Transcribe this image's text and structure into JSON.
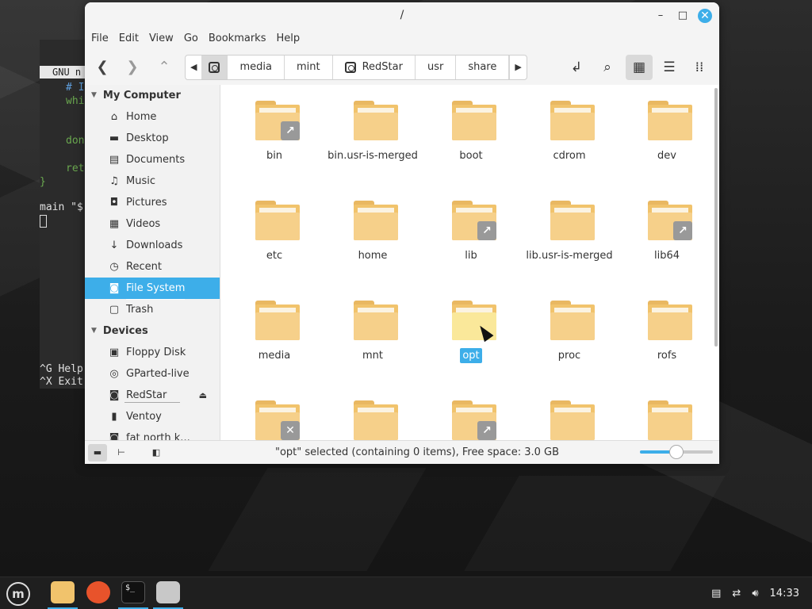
{
  "window": {
    "title": "/"
  },
  "menubar": [
    "File",
    "Edit",
    "View",
    "Go",
    "Bookmarks",
    "Help"
  ],
  "breadcrumbs": [
    "media",
    "mint",
    "RedStar",
    "usr",
    "share"
  ],
  "sidebar": {
    "sections": [
      {
        "title": "My Computer",
        "items": [
          {
            "label": "Home",
            "icon": "home-icon",
            "glyph": "⌂"
          },
          {
            "label": "Desktop",
            "icon": "desktop-icon",
            "glyph": "▬"
          },
          {
            "label": "Documents",
            "icon": "documents-icon",
            "glyph": "▤"
          },
          {
            "label": "Music",
            "icon": "music-icon",
            "glyph": "♫"
          },
          {
            "label": "Pictures",
            "icon": "camera-icon",
            "glyph": "◘"
          },
          {
            "label": "Videos",
            "icon": "film-icon",
            "glyph": "▦"
          },
          {
            "label": "Downloads",
            "icon": "download-icon",
            "glyph": "↓"
          },
          {
            "label": "Recent",
            "icon": "clock-icon",
            "glyph": "◷"
          },
          {
            "label": "File System",
            "icon": "drive-icon",
            "glyph": "◙",
            "selected": true
          },
          {
            "label": "Trash",
            "icon": "trash-icon",
            "glyph": "▢"
          }
        ]
      },
      {
        "title": "Devices",
        "items": [
          {
            "label": "Floppy Disk",
            "icon": "floppy-icon",
            "glyph": "▣"
          },
          {
            "label": "GParted-live",
            "icon": "disc-icon",
            "glyph": "◎"
          },
          {
            "label": "RedStar",
            "icon": "drive-icon",
            "glyph": "◙",
            "eject": true
          },
          {
            "label": "Ventoy",
            "icon": "usb-icon",
            "glyph": "▮"
          },
          {
            "label": "fat north k...",
            "icon": "drive-icon",
            "glyph": "◙"
          }
        ]
      }
    ]
  },
  "files": [
    {
      "name": "bin",
      "emblem": "link"
    },
    {
      "name": "bin.usr-is-merged"
    },
    {
      "name": "boot"
    },
    {
      "name": "cdrom"
    },
    {
      "name": "dev"
    },
    {
      "name": "etc"
    },
    {
      "name": "home"
    },
    {
      "name": "lib",
      "emblem": "link"
    },
    {
      "name": "lib.usr-is-merged"
    },
    {
      "name": "lib64",
      "emblem": "link"
    },
    {
      "name": "media"
    },
    {
      "name": "mnt"
    },
    {
      "name": "opt",
      "selected": true
    },
    {
      "name": "proc"
    },
    {
      "name": "rofs"
    },
    {
      "name": "",
      "emblem": "unreadable"
    },
    {
      "name": ""
    },
    {
      "name": "",
      "emblem": "link"
    },
    {
      "name": ""
    },
    {
      "name": ""
    }
  ],
  "status": {
    "text": "\"opt\" selected (containing 0 items), Free space: 3.0 GB",
    "zoom_level": 0.5
  },
  "terminal": {
    "header": "GNU n",
    "lines": [
      {
        "text": "# I",
        "cls": "cmt"
      },
      {
        "text": "whi",
        "cls": "grn"
      },
      {
        "text": "don",
        "cls": "grn"
      },
      {
        "text": "ret",
        "cls": "grn"
      },
      {
        "text": "}",
        "cls": "grn"
      },
      {
        "text": "main \"$",
        "cls": "wht"
      }
    ],
    "shortcuts": [
      "^G Help",
      "^X Exit"
    ]
  },
  "taskbar": {
    "apps": [
      "files",
      "firefox",
      "terminal",
      "disk-utility"
    ],
    "clock": "14:33"
  },
  "colors": {
    "accent": "#3daee9",
    "folder": "#f6d08a"
  }
}
